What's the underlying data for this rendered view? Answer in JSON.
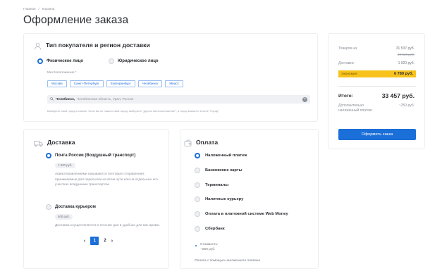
{
  "breadcrumb": {
    "home": "Главная",
    "sep": "/",
    "current": "Корзина"
  },
  "page_title": "Оформление заказа",
  "buyer": {
    "title": "Тип покупателя и регион доставки",
    "types": [
      "Физическое лицо",
      "Юридическое лицо"
    ],
    "selected_type": 0,
    "location_label": "Местоположение *",
    "cities": [
      "Москва",
      "Санкт-Петербург",
      "Екатеринбург",
      "Челябинск",
      "Миасс"
    ],
    "location_city": "Челябинск,",
    "location_region": "Челябинская область, Урал, Россия",
    "hint": "Выберите свой город в списке. Если вы не нашли свой город, выберите \"другое местоположение\", а город впишите в поле \"Город\""
  },
  "delivery": {
    "title": "Доставка",
    "options": [
      {
        "name": "Почта России (Воздушный транспорт)",
        "price": "1 920 руб.",
        "desc": "Авиаотправлениями называются почтовые отправления, принимаемые для пересылки на всем пути или на отдельных его участках воздушным транспортом."
      },
      {
        "name": "Доставка курьером",
        "price": "500 руб.",
        "desc": "Доставка осуществляется в течение дня в удобное для вас время."
      }
    ],
    "pager": {
      "prev": "‹",
      "current": "1",
      "next_page": "2",
      "next": "›"
    }
  },
  "payment": {
    "title": "Оплата",
    "methods": [
      "Наложенный платеж",
      "Банковские карты",
      "Терминалы",
      "Наличные курьеру",
      "Оплата в платежной системе Web Money",
      "Сбербанк"
    ],
    "selected": 0,
    "cost_label": "Стоимость:",
    "cost_value": "~250 руб.",
    "footnote": "Оплата с помощью наложенного платежа"
  },
  "summary": {
    "goods_label": "Товаров на:",
    "goods_value": "31 537 руб.",
    "goods_old": "38 326 руб.",
    "delivery_label": "Доставка:",
    "delivery_value": "1 920 руб.",
    "economy_label": "Экономия:",
    "economy_value": "6 789 руб.",
    "total_label": "Итого:",
    "total_value": "33 457 руб.",
    "cod_label": "Дополнительно наложенный платеж:",
    "cod_value": "~250 руб.",
    "order_button": "Оформить заказ"
  },
  "colors": {
    "accent": "#1b6fd8",
    "economy": "#f8c21c"
  }
}
